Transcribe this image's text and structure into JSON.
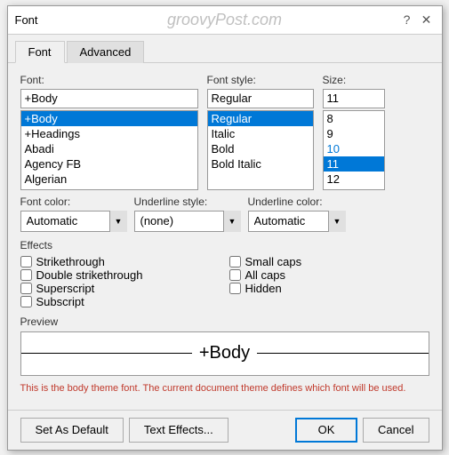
{
  "dialog": {
    "title": "Font",
    "watermark": "groovyPost.com"
  },
  "tabs": [
    {
      "label": "Font",
      "active": true
    },
    {
      "label": "Advanced",
      "active": false
    }
  ],
  "font_section": {
    "label": "Font:",
    "input_value": "+Body",
    "items": [
      {
        "text": "+Body",
        "selected": true
      },
      {
        "text": "+Headings",
        "selected": false
      },
      {
        "text": "Abadi",
        "selected": false
      },
      {
        "text": "Agency FB",
        "selected": false
      },
      {
        "text": "Algerian",
        "selected": false
      }
    ]
  },
  "style_section": {
    "label": "Font style:",
    "input_value": "Regular",
    "items": [
      {
        "text": "Regular",
        "selected": true
      },
      {
        "text": "Italic",
        "selected": false
      },
      {
        "text": "Bold",
        "selected": false
      },
      {
        "text": "Bold Italic",
        "selected": false
      }
    ]
  },
  "size_section": {
    "label": "Size:",
    "input_value": "11",
    "items": [
      {
        "text": "8",
        "selected": false
      },
      {
        "text": "9",
        "selected": false
      },
      {
        "text": "10",
        "selected": false
      },
      {
        "text": "11",
        "selected": true
      },
      {
        "text": "12",
        "selected": false
      }
    ]
  },
  "font_color": {
    "label": "Font color:",
    "value": "Automatic"
  },
  "underline_style": {
    "label": "Underline style:",
    "value": "(none)"
  },
  "underline_color": {
    "label": "Underline color:",
    "value": "Automatic"
  },
  "effects": {
    "title": "Effects",
    "items": [
      {
        "label": "Strikethrough",
        "checked": false,
        "col": 1
      },
      {
        "label": "Small caps",
        "checked": false,
        "col": 2
      },
      {
        "label": "Double strikethrough",
        "checked": false,
        "col": 1
      },
      {
        "label": "All caps",
        "checked": false,
        "col": 2
      },
      {
        "label": "Superscript",
        "checked": false,
        "col": 1
      },
      {
        "label": "Hidden",
        "checked": false,
        "col": 2
      },
      {
        "label": "Subscript",
        "checked": false,
        "col": 1
      }
    ]
  },
  "preview": {
    "label": "Preview",
    "text": "+Body"
  },
  "info": {
    "text": "This is the body theme font. The current document theme defines which font will be used."
  },
  "footer": {
    "set_default": "Set As Default",
    "text_effects": "Text Effects...",
    "ok": "OK",
    "cancel": "Cancel"
  },
  "icons": {
    "help": "?",
    "close": "✕",
    "scroll_down": "▼",
    "scroll_up": "▲"
  }
}
